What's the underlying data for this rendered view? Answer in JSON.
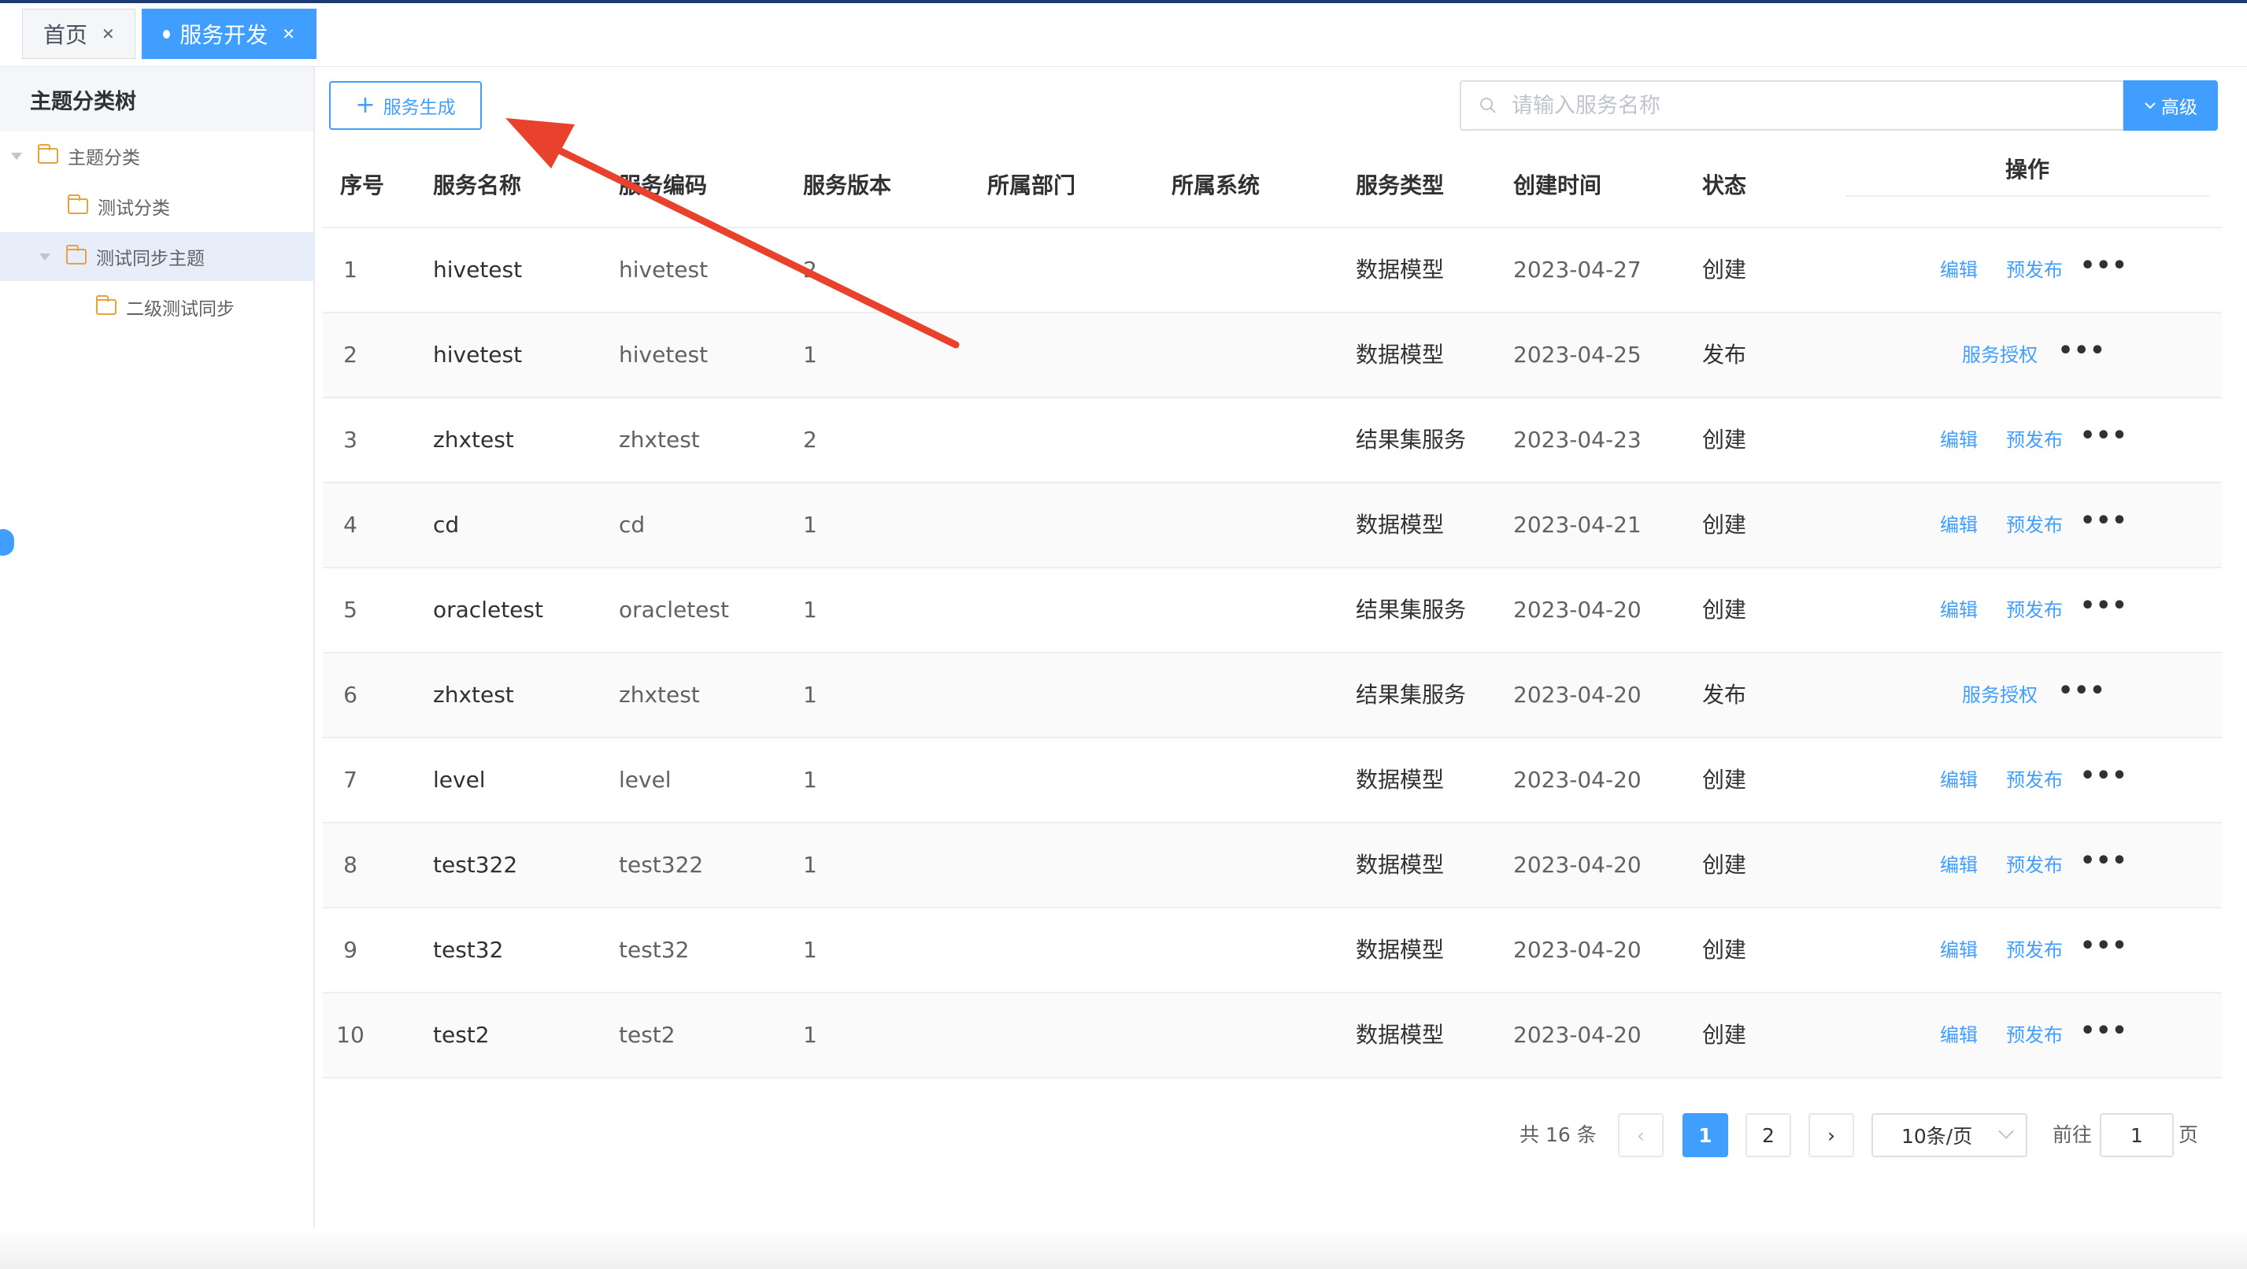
{
  "tabs": [
    {
      "label": "首页",
      "active": false
    },
    {
      "label": "服务开发",
      "active": true
    }
  ],
  "sidebar": {
    "title": "主题分类树",
    "tree": [
      {
        "label": "主题分类",
        "level": 0,
        "expanded": true,
        "selected": false
      },
      {
        "label": "测试分类",
        "level": 1,
        "expanded": false,
        "selected": false
      },
      {
        "label": "测试同步主题",
        "level": 1,
        "expanded": true,
        "selected": true
      },
      {
        "label": "二级测试同步",
        "level": 2,
        "expanded": false,
        "selected": false
      }
    ]
  },
  "toolbar": {
    "generate_label": "服务生成",
    "search_placeholder": "请输入服务名称",
    "advanced_label": "高级"
  },
  "table": {
    "columns": [
      "序号",
      "服务名称",
      "服务编码",
      "服务版本",
      "所属部门",
      "所属系统",
      "服务类型",
      "创建时间",
      "状态",
      "操作"
    ],
    "rows": [
      {
        "idx": "1",
        "name": "hivetest",
        "code": "hivetest",
        "version": "2",
        "dept": "",
        "system": "",
        "type": "数据模型",
        "created": "2023-04-27",
        "status": "创建",
        "actions": [
          "编辑",
          "预发布"
        ]
      },
      {
        "idx": "2",
        "name": "hivetest",
        "code": "hivetest",
        "version": "1",
        "dept": "",
        "system": "",
        "type": "数据模型",
        "created": "2023-04-25",
        "status": "发布",
        "actions": [
          "服务授权"
        ]
      },
      {
        "idx": "3",
        "name": "zhxtest",
        "code": "zhxtest",
        "version": "2",
        "dept": "",
        "system": "",
        "type": "结果集服务",
        "created": "2023-04-23",
        "status": "创建",
        "actions": [
          "编辑",
          "预发布"
        ]
      },
      {
        "idx": "4",
        "name": "cd",
        "code": "cd",
        "version": "1",
        "dept": "",
        "system": "",
        "type": "数据模型",
        "created": "2023-04-21",
        "status": "创建",
        "actions": [
          "编辑",
          "预发布"
        ]
      },
      {
        "idx": "5",
        "name": "oracletest",
        "code": "oracletest",
        "version": "1",
        "dept": "",
        "system": "",
        "type": "结果集服务",
        "created": "2023-04-20",
        "status": "创建",
        "actions": [
          "编辑",
          "预发布"
        ]
      },
      {
        "idx": "6",
        "name": "zhxtest",
        "code": "zhxtest",
        "version": "1",
        "dept": "",
        "system": "",
        "type": "结果集服务",
        "created": "2023-04-20",
        "status": "发布",
        "actions": [
          "服务授权"
        ]
      },
      {
        "idx": "7",
        "name": "level",
        "code": "level",
        "version": "1",
        "dept": "",
        "system": "",
        "type": "数据模型",
        "created": "2023-04-20",
        "status": "创建",
        "actions": [
          "编辑",
          "预发布"
        ]
      },
      {
        "idx": "8",
        "name": "test322",
        "code": "test322",
        "version": "1",
        "dept": "",
        "system": "",
        "type": "数据模型",
        "created": "2023-04-20",
        "status": "创建",
        "actions": [
          "编辑",
          "预发布"
        ]
      },
      {
        "idx": "9",
        "name": "test32",
        "code": "test32",
        "version": "1",
        "dept": "",
        "system": "",
        "type": "数据模型",
        "created": "2023-04-20",
        "status": "创建",
        "actions": [
          "编辑",
          "预发布"
        ]
      },
      {
        "idx": "10",
        "name": "test2",
        "code": "test2",
        "version": "1",
        "dept": "",
        "system": "",
        "type": "数据模型",
        "created": "2023-04-20",
        "status": "创建",
        "actions": [
          "编辑",
          "预发布"
        ]
      }
    ],
    "more_glyph": "•••"
  },
  "pagination": {
    "total_text": "共 16 条",
    "pages": [
      "1",
      "2"
    ],
    "current_page": "1",
    "page_size": "10条/页",
    "goto_prefix": "前往",
    "goto_value": "1",
    "goto_suffix": "页"
  },
  "colors": {
    "accent": "#409eff",
    "annotation_arrow": "#e8412c",
    "folder": "#e6a23c"
  },
  "icons": [
    "close-icon",
    "plus-icon",
    "search-icon",
    "chevron-down-icon",
    "folder-icon",
    "caret-down-icon",
    "more-icon",
    "chevron-left-icon",
    "chevron-right-icon"
  ]
}
